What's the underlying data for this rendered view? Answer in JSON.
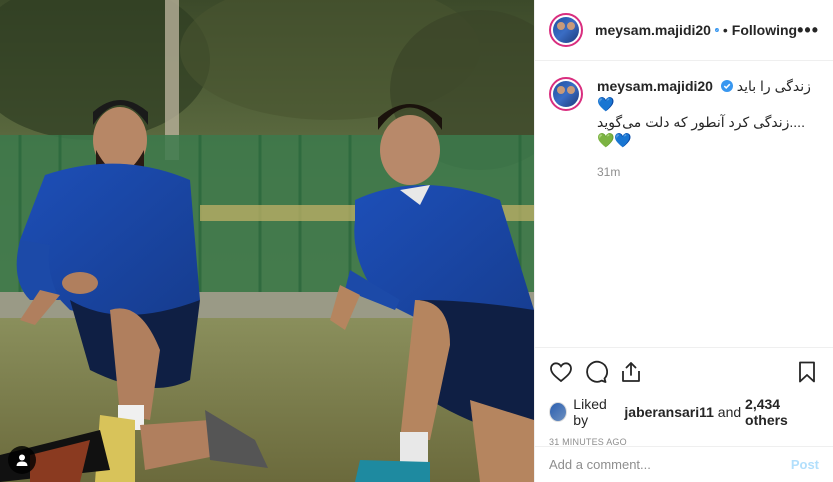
{
  "post": {
    "author": "meysam.majidi20",
    "follow_separator": "•",
    "follow_state": "Following",
    "more_label": "•••",
    "caption_line1": "زندگی را باید💙",
    "caption_line2": "....زندگی کرد آنطور که دلت می‌گوید",
    "caption_line3": "💚💙",
    "caption_time": "31m",
    "liked_by_prefix": "Liked by",
    "liked_by_user": "jaberansari11",
    "liked_by_and": "and",
    "liked_by_others": "2,434 others",
    "posted_ago": "31 MINUTES AGO"
  },
  "comment_box": {
    "placeholder": "Add a comment...",
    "post_label": "Post"
  },
  "icons": {
    "verified": "verified-badge-icon",
    "like": "heart-icon",
    "comment": "comment-icon",
    "share": "share-icon",
    "save": "bookmark-icon",
    "tag": "user-tag-icon"
  },
  "colors": {
    "verified_blue": "#3897f0",
    "story_ring": "#d92e7f",
    "post_button_disabled": "#b2dffc",
    "muted_text": "#8e8e8e"
  }
}
